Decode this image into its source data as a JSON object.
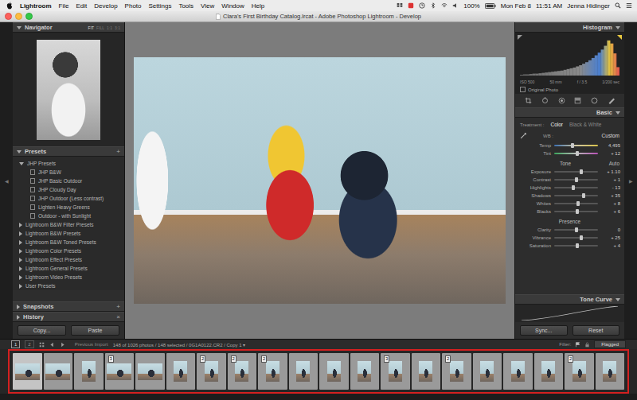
{
  "menubar": {
    "menus": [
      "Lightroom",
      "File",
      "Edit",
      "Develop",
      "Photo",
      "Settings",
      "Tools",
      "View",
      "Window",
      "Help"
    ],
    "battery": "100%",
    "date": "Mon Feb 8",
    "time": "11:51 AM",
    "user": "Jenna Hidinger"
  },
  "window": {
    "title": "Clara's First Birthday Catalog.lrcat - Adobe Photoshop Lightroom - Develop"
  },
  "gutters": {
    "left": "◀",
    "right": "▶"
  },
  "navigator": {
    "title": "Navigator",
    "zoom": [
      {
        "label": "FIT",
        "selected": true
      },
      {
        "label": "FILL",
        "selected": false
      },
      {
        "label": "1:1",
        "selected": false
      },
      {
        "label": "3:1",
        "selected": false
      }
    ]
  },
  "presets": {
    "title": "Presets",
    "add": "+",
    "groups": [
      {
        "label": "JHP Presets",
        "expanded": true,
        "items": [
          "JHP B&W",
          "JHP Basic Outdoor",
          "JHP Cloudy Day",
          "JHP Outdoor (Less contrast)",
          "Lighten Heavy Greens",
          "Outdoor - with Sunlight"
        ]
      },
      {
        "label": "Lightroom B&W Filter Presets",
        "expanded": false,
        "items": []
      },
      {
        "label": "Lightroom B&W Presets",
        "expanded": false,
        "items": []
      },
      {
        "label": "Lightroom B&W Toned Presets",
        "expanded": false,
        "items": []
      },
      {
        "label": "Lightroom Color Presets",
        "expanded": false,
        "items": []
      },
      {
        "label": "Lightroom Effect Presets",
        "expanded": false,
        "items": []
      },
      {
        "label": "Lightroom General Presets",
        "expanded": false,
        "items": []
      },
      {
        "label": "Lightroom Video Presets",
        "expanded": false,
        "items": []
      },
      {
        "label": "User Presets",
        "expanded": false,
        "items": []
      }
    ]
  },
  "snapshots": {
    "title": "Snapshots",
    "add": "+"
  },
  "history": {
    "title": "History",
    "clear": "×"
  },
  "left_buttons": [
    "Copy...",
    "Paste"
  ],
  "histogram": {
    "title": "Histogram",
    "values": [
      2,
      3,
      3,
      4,
      5,
      5,
      6,
      7,
      8,
      9,
      10,
      11,
      12,
      13,
      15,
      17,
      19,
      21,
      24,
      27,
      31,
      35,
      40,
      46,
      53,
      60,
      68,
      78,
      92,
      84,
      58,
      22
    ],
    "exif": [
      "ISO 500",
      "50 mm",
      "f / 3.5",
      "1/200 sec"
    ],
    "original": {
      "label": "Original Photo",
      "checked": false
    }
  },
  "basic": {
    "title": "Basic",
    "treatment": {
      "label": "Treatment :",
      "options": [
        {
          "label": "Color",
          "selected": true
        },
        {
          "label": "Black & White",
          "selected": false
        }
      ]
    },
    "wb": {
      "label": "WB :",
      "value": "Custom"
    },
    "wb_sliders": [
      {
        "name": "Temp",
        "reading": "4,495",
        "level": 0.42,
        "kind": "temp"
      },
      {
        "name": "Tint",
        "reading": "+ 12",
        "level": 0.53,
        "kind": "tint"
      }
    ],
    "tone": {
      "label": "Tone",
      "auto": "Auto",
      "sliders": [
        {
          "name": "Exposure",
          "reading": "+ 1.10",
          "level": 0.61,
          "kind": "plain"
        },
        {
          "name": "Contrast",
          "reading": "+ 1",
          "level": 0.5,
          "kind": "plain"
        },
        {
          "name": "Highlights",
          "reading": "- 13",
          "level": 0.44,
          "kind": "plain"
        },
        {
          "name": "Shadows",
          "reading": "+ 35",
          "level": 0.67,
          "kind": "plain"
        },
        {
          "name": "Whites",
          "reading": "+ 8",
          "level": 0.54,
          "kind": "plain"
        },
        {
          "name": "Blacks",
          "reading": "+ 6",
          "level": 0.53,
          "kind": "plain"
        }
      ]
    },
    "presence": {
      "label": "Presence",
      "sliders": [
        {
          "name": "Clarity",
          "reading": "0",
          "level": 0.5,
          "kind": "plain"
        },
        {
          "name": "Vibrance",
          "reading": "+ 25",
          "level": 0.62,
          "kind": "plain"
        },
        {
          "name": "Saturation",
          "reading": "+ 4",
          "level": 0.52,
          "kind": "plain"
        }
      ]
    }
  },
  "tone_curve": {
    "title": "Tone Curve"
  },
  "right_buttons": [
    "Sync...",
    "Reset"
  ],
  "toolbar": {
    "views": [
      {
        "label": "1",
        "selected": true
      },
      {
        "label": "2",
        "selected": false
      }
    ],
    "source": "Previous Import",
    "info": "148 of 1026 photos / 148 selected / 0G1A0122.CR2 / Copy 1 ▾",
    "filter_label": "Filter:",
    "filter_value": "Flagged"
  },
  "filmstrip": [
    {
      "kind": "landscape",
      "badge": null,
      "selected": true,
      "active": true
    },
    {
      "kind": "landscape",
      "badge": null,
      "selected": true,
      "active": false
    },
    {
      "kind": "portrait",
      "badge": null,
      "selected": true,
      "active": false
    },
    {
      "kind": "landscape",
      "badge": "3",
      "selected": true,
      "active": false
    },
    {
      "kind": "landscape",
      "badge": null,
      "selected": true,
      "active": false
    },
    {
      "kind": "portrait",
      "badge": null,
      "selected": true,
      "active": false
    },
    {
      "kind": "portrait",
      "badge": "2",
      "selected": true,
      "active": false
    },
    {
      "kind": "portrait",
      "badge": "2",
      "selected": true,
      "active": false
    },
    {
      "kind": "portrait",
      "badge": "2",
      "selected": true,
      "active": false
    },
    {
      "kind": "portrait",
      "badge": null,
      "selected": true,
      "active": false
    },
    {
      "kind": "portrait",
      "badge": null,
      "selected": true,
      "active": false
    },
    {
      "kind": "portrait",
      "badge": null,
      "selected": true,
      "active": false
    },
    {
      "kind": "portrait",
      "badge": "3",
      "selected": true,
      "active": false
    },
    {
      "kind": "portrait",
      "badge": null,
      "selected": true,
      "active": false
    },
    {
      "kind": "portrait",
      "badge": "2",
      "selected": true,
      "active": false
    },
    {
      "kind": "portrait",
      "badge": null,
      "selected": true,
      "active": false
    },
    {
      "kind": "portrait",
      "badge": null,
      "selected": true,
      "active": false
    },
    {
      "kind": "portrait",
      "badge": null,
      "selected": true,
      "active": false
    },
    {
      "kind": "portrait",
      "badge": "2",
      "selected": true,
      "active": false
    },
    {
      "kind": "portrait",
      "badge": null,
      "selected": true,
      "active": false
    }
  ]
}
